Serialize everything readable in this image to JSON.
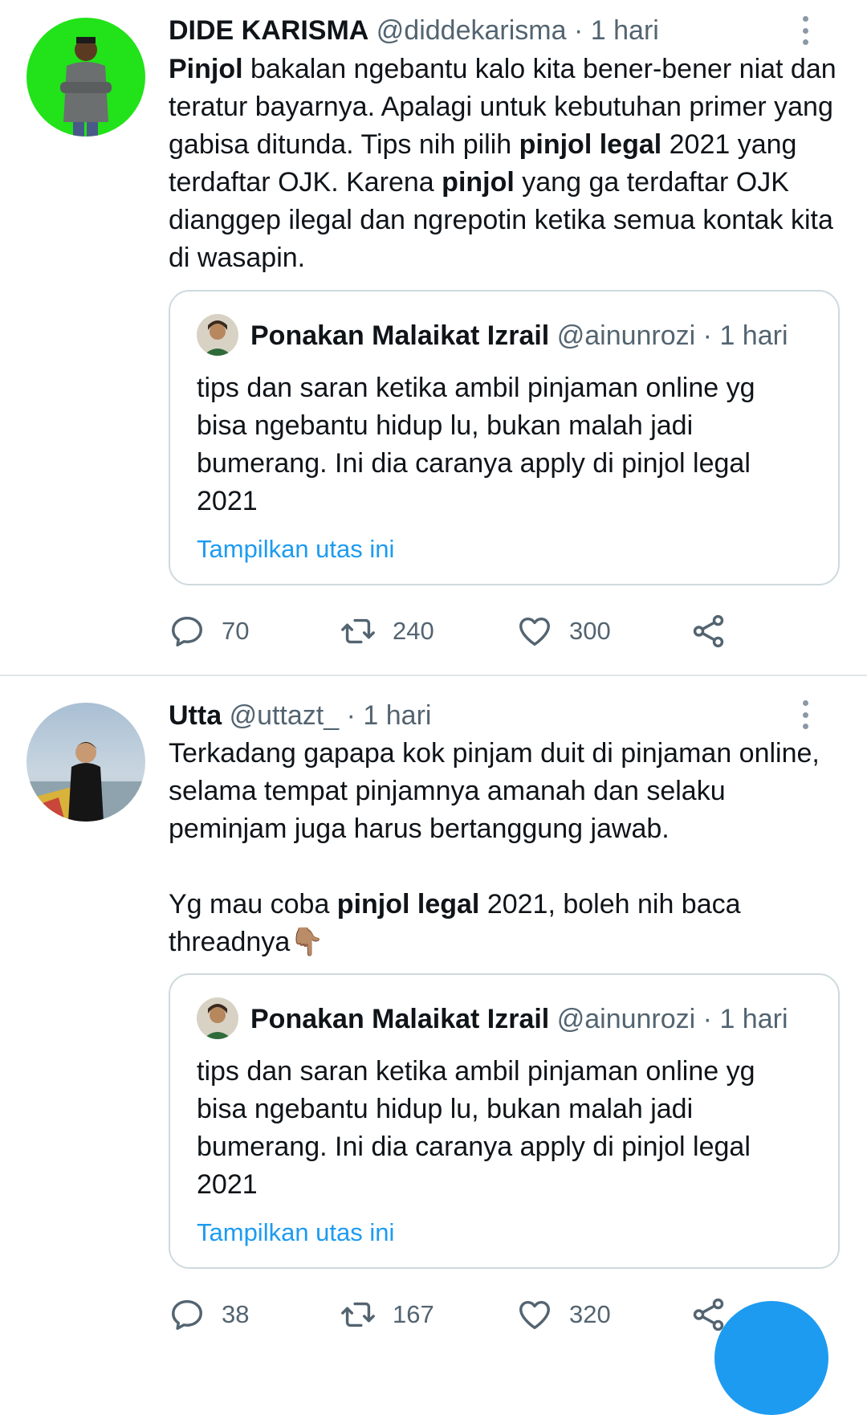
{
  "tweets": [
    {
      "name": "DIDE KARISMA",
      "handle": "@diddekarisma",
      "dot": "·",
      "time": "1 hari",
      "body": [
        {
          "t": "Pinjol",
          "b": true
        },
        {
          "t": " bakalan ngebantu kalo kita bener-bener niat dan teratur bayarnya. Apalagi untuk kebutuhan primer yang gabisa ditunda. Tips nih pilih ",
          "b": false
        },
        {
          "t": "pinjol legal",
          "b": true
        },
        {
          "t": " 2021 yang terdaftar OJK. Karena ",
          "b": false
        },
        {
          "t": "pinjol",
          "b": true
        },
        {
          "t": " yang ga terdaftar OJK dianggep ilegal dan ngrepotin ketika semua kontak kita di wasapin.",
          "b": false
        }
      ],
      "quote": {
        "name": "Ponakan Malaikat Izrail",
        "handle": "@ainunrozi",
        "dot": "·",
        "time": "1 hari",
        "text": "tips dan saran ketika ambil pinjaman online yg bisa ngebantu hidup lu, bukan malah jadi bumerang. Ini dia caranya apply di pinjol legal 2021",
        "link": "Tampilkan utas ini"
      },
      "stats": {
        "replies": "70",
        "retweets": "240",
        "likes": "300"
      }
    },
    {
      "name": "Utta",
      "handle": "@uttazt_",
      "dot": "·",
      "time": "1 hari",
      "body1": "Terkadang gapapa kok pinjam duit di pinjaman online, selama tempat pinjamnya amanah dan selaku peminjam juga harus bertanggung jawab.",
      "body2": [
        {
          "t": "Yg mau coba ",
          "b": false
        },
        {
          "t": "pinjol legal",
          "b": true
        },
        {
          "t": " 2021, boleh nih baca threadnya",
          "b": false
        }
      ],
      "emoji": "👇🏽",
      "quote": {
        "name": "Ponakan Malaikat Izrail",
        "handle": "@ainunrozi",
        "dot": "·",
        "time": "1 hari",
        "text": "tips dan saran ketika ambil pinjaman online yg bisa ngebantu hidup lu, bukan malah jadi bumerang. Ini dia caranya apply di pinjol legal 2021",
        "link": "Tampilkan utas ini"
      },
      "stats": {
        "replies": "38",
        "retweets": "167",
        "likes": "320"
      }
    }
  ],
  "icons": {
    "reply": "reply-icon",
    "retweet": "retweet-icon",
    "like": "heart-icon",
    "share": "share-icon",
    "more": "more-vertical-icon"
  },
  "colors": {
    "text": "#0f1419",
    "muted": "#536471",
    "link": "#1d9bf0",
    "border": "#cfd9de",
    "avatar1_bg": "#22e21a",
    "fab": "#1d9bf0"
  }
}
